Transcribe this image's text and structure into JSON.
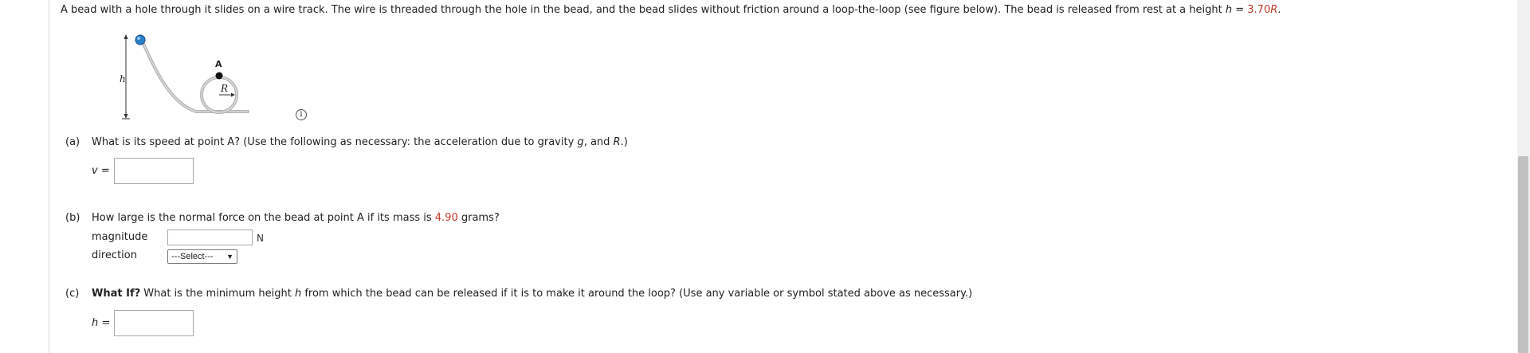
{
  "intro": {
    "text_before": "A bead with a hole through it slides on a wire track. The wire is threaded through the hole in the bead, and the bead slides without friction around a loop-the-loop (see figure below). The bead is released from rest at a height ",
    "h_var": "h",
    "equals": " = ",
    "h_value": "3.70",
    "h_unit_var": "R",
    "period": "."
  },
  "figure": {
    "label_h": "h",
    "label_A": "A",
    "label_R": "R",
    "info_icon_glyph": "i"
  },
  "part_a": {
    "letter": "(a)",
    "question": "What is its speed at point A? (Use the following as necessary: the acceleration due to gravity ",
    "var_g": "g",
    "mid": ", and ",
    "var_R": "R",
    "end": ".)",
    "answer_label": "v =",
    "answer_value": ""
  },
  "part_b": {
    "letter": "(b)",
    "question_before": "How large is the normal force on the bead at point A if its mass is ",
    "mass_value": "4.90",
    "question_after": " grams?",
    "magnitude_label": "magnitude",
    "magnitude_value": "",
    "unit": "N",
    "direction_label": "direction",
    "direction_selected": "---Select---"
  },
  "part_c": {
    "letter": "(c)",
    "what_if": "What If?",
    "question_before": " What is the minimum height ",
    "var_h": "h",
    "question_after": " from which the bead can be released if it is to make it around the loop? (Use any variable or symbol stated above as necessary.)",
    "answer_label": "h =",
    "answer_value": ""
  },
  "colors": {
    "highlight_red": "#c0392b",
    "bead_blue": "#2a7fc9",
    "wire_gray": "#b5b5b5"
  }
}
